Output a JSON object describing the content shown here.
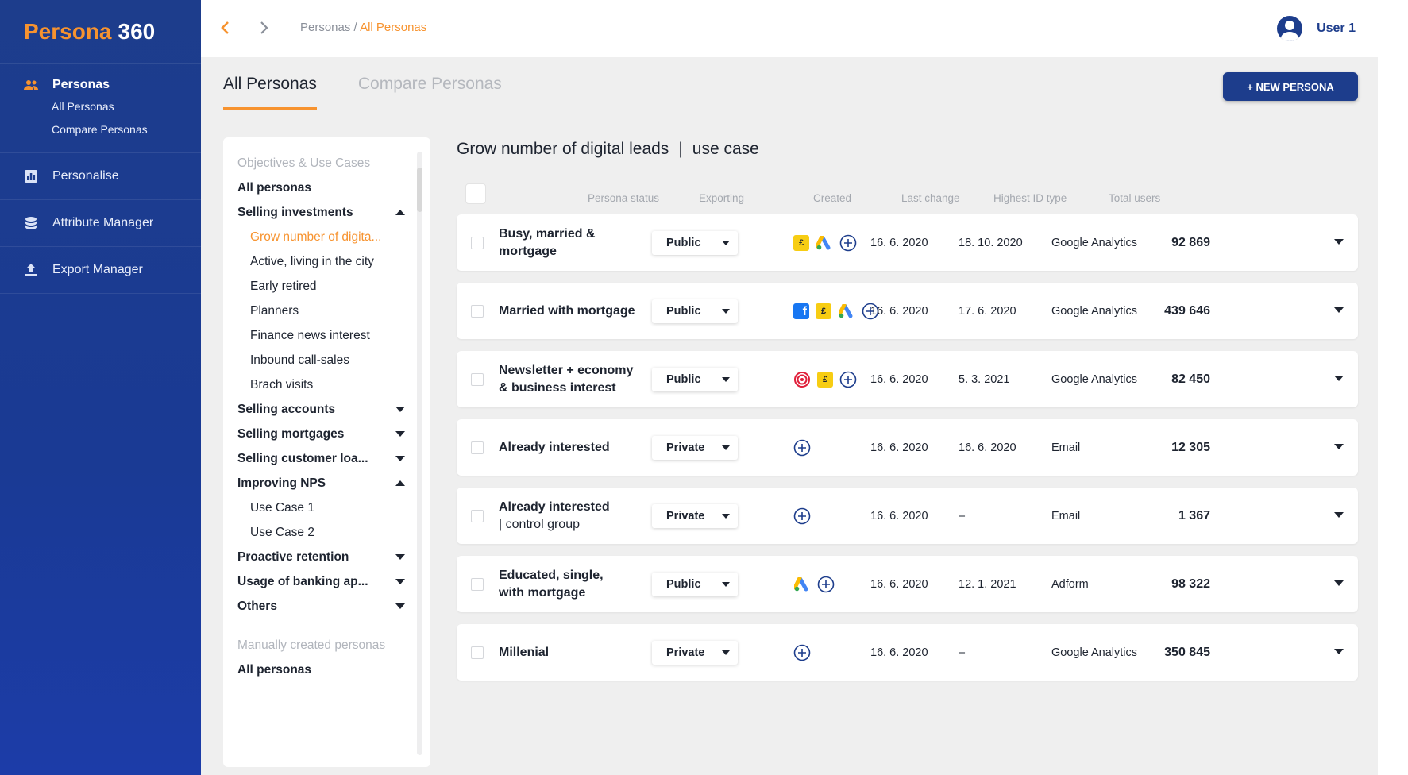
{
  "app": {
    "logo_part1": "Persona",
    "logo_part2": "360"
  },
  "sidebar": {
    "personas_label": "Personas",
    "sub_items": [
      "All Personas",
      "Compare Personas"
    ],
    "items": [
      {
        "label": "Personalise",
        "icon": "chart-icon"
      },
      {
        "label": "Attribute Manager",
        "icon": "database-icon"
      },
      {
        "label": "Export Manager",
        "icon": "upload-icon"
      }
    ]
  },
  "topbar": {
    "breadcrumb_root": "Personas",
    "breadcrumb_sep": " / ",
    "breadcrumb_current": "All Personas",
    "user_name": "User 1"
  },
  "tabs": [
    "All Personas",
    "Compare Personas"
  ],
  "new_persona_button": "+ NEW PERSONA",
  "panel": {
    "section1_caption": "Objectives & Use Cases",
    "section2_caption": "Manually created personas",
    "all_personas": "All personas",
    "groups": {
      "selling_investments": "Selling investments",
      "grow": "Grow number of digita...",
      "active": "Active, living in the city",
      "early": "Early retired",
      "planners": "Planners",
      "finance": "Finance news interest",
      "inbound": "Inbound call-sales",
      "brach": "Brach visits",
      "selling_accounts": "Selling accounts",
      "selling_mortgages": "Selling mortgages",
      "selling_customer": "Selling customer loa...",
      "improving_nps": "Improving NPS",
      "use_case_1": "Use Case 1",
      "use_case_2": "Use Case 2",
      "proactive": "Proactive retention",
      "usage": "Usage of banking ap...",
      "others": "Others"
    },
    "all_personas_2": "All personas"
  },
  "content": {
    "title": "Grow number of digital leads",
    "title_sep": "|",
    "title_suffix": "use case",
    "columns": {
      "status": "Persona status",
      "exporting": "Exporting",
      "created": "Created",
      "last_change": "Last change",
      "id_type": "Highest ID type",
      "total": "Total users"
    },
    "rows": [
      {
        "name1": "Busy, married &",
        "name2": "mortgage",
        "name2_bold": true,
        "status": "Public",
        "created": "16. 6. 2020",
        "last_change": "18. 10. 2020",
        "id_type": "Google Analytics",
        "total": "92 869"
      },
      {
        "name1": "Married with mortgage",
        "name2": "",
        "name2_bold": true,
        "status": "Public",
        "created": "16. 6. 2020",
        "last_change": "17. 6. 2020",
        "id_type": "Google Analytics",
        "total": "439 646"
      },
      {
        "name1": "Newsletter + economy",
        "name2": "& business interest",
        "name2_bold": true,
        "status": "Public",
        "created": "16. 6. 2020",
        "last_change": "5. 3. 2021",
        "id_type": "Google Analytics",
        "total": "82 450"
      },
      {
        "name1": "Already interested",
        "name2": "",
        "name2_bold": true,
        "status": "Private",
        "created": "16. 6. 2020",
        "last_change": "16. 6. 2020",
        "id_type": "Email",
        "total": "12 305"
      },
      {
        "name1": "Already interested",
        "name2": "| control group",
        "name2_bold": false,
        "status": "Private",
        "created": "16. 6. 2020",
        "last_change": "–",
        "id_type": "Email",
        "total": "1 367"
      },
      {
        "name1": "Educated, single,",
        "name2": "with mortgage",
        "name2_bold": true,
        "status": "Public",
        "created": "16. 6. 2020",
        "last_change": "12. 1. 2021",
        "id_type": "Adform",
        "total": "98 322"
      },
      {
        "name1": "Millenial",
        "name2": "",
        "name2_bold": true,
        "status": "Private",
        "created": "16. 6. 2020",
        "last_change": "–",
        "id_type": "Google Analytics",
        "total": "350 845"
      }
    ],
    "exports": [
      [
        "e-icon",
        "google-ads-icon",
        "add-export-icon"
      ],
      [
        "facebook-icon",
        "e-icon",
        "google-ads-icon",
        "add-export-icon"
      ],
      [
        "target-icon",
        "e-icon",
        "add-export-icon"
      ],
      [
        "add-export-icon"
      ],
      [
        "add-export-icon"
      ],
      [
        "google-ads-icon",
        "add-export-icon"
      ],
      [
        "add-export-icon"
      ]
    ]
  },
  "colors": {
    "accent": "#f7932f",
    "brand": "#1d3d8c"
  }
}
